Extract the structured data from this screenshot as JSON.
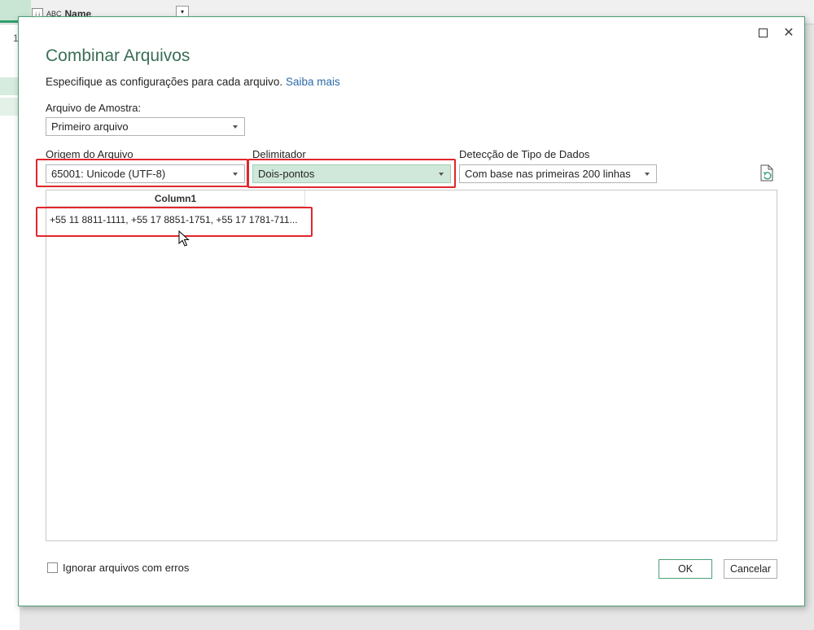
{
  "background": {
    "column_header": "Name",
    "column_type_icon": "ABC",
    "row_number": "1"
  },
  "dialog": {
    "title": "Combinar Arquivos",
    "subtitle": "Especifique as configurações para cada arquivo.",
    "learn_more_link": "Saiba mais",
    "sample_file": {
      "label": "Arquivo de Amostra:",
      "value": "Primeiro arquivo"
    },
    "file_origin": {
      "label": "Origem do Arquivo",
      "value": "65001: Unicode (UTF-8)"
    },
    "delimiter": {
      "label": "Delimitador",
      "value": "Dois-pontos"
    },
    "data_type_detection": {
      "label": "Detecção de Tipo de Dados",
      "value": "Com base nas primeiras 200 linhas"
    },
    "preview": {
      "column_header": "Column1",
      "cell_value": "+55 11 8811-1111, +55 17 8851-1751, +55 17 1781-711..."
    },
    "ignore_errors_label": "Ignorar arquivos com erros",
    "ok_label": "OK",
    "cancel_label": "Cancelar",
    "close_glyph": "✕"
  },
  "colors": {
    "accent_green": "#4c9f76",
    "highlight_red": "#e0262d",
    "link_blue": "#2b6aa8",
    "delimiter_bg": "#cfe8da"
  },
  "icons": [
    "maximize-icon",
    "close-icon",
    "chevron-down-icon",
    "refresh-file-icon",
    "mouse-cursor-icon"
  ]
}
